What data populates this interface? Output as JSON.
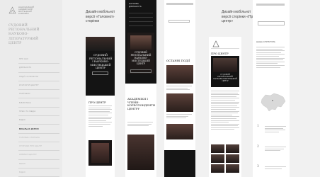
{
  "sidebar": {
    "logo_text": [
      "НАЦІОНАЛЬНИЙ",
      "АКАДЕМІЧНИЙ МИСТЕЦЬКИЙ",
      "КОМПЛЕКС"
    ],
    "title_lines": [
      "СУДОВИЙ РЕГІОНАЛЬНИЙ",
      "НАУКОВО-ЛІТЕРАТУРНИЙ",
      "ЦЕНТР"
    ],
    "nav": [
      {
        "label": "ПРО НАС",
        "state": "normal"
      },
      {
        "label": "ДІЯЛЬНІСТЬ",
        "state": "normal"
      },
      {
        "label": "ПОДІЇ ТА ПРОЄКТИ",
        "state": "normal"
      },
      {
        "label": "КОНТАКТИ ЦЕНТРУ",
        "state": "normal"
      },
      {
        "label": "ПАРТНЕРИ",
        "state": "normal"
      },
      {
        "label": "БІБЛІОТЕКА",
        "state": "normal"
      },
      {
        "label": "ПРЕСІ ТА МЕДІА",
        "state": "normal"
      },
      {
        "label": "ВІДЕО",
        "state": "normal"
      },
      {
        "label": "МОБІЛЬНА ВЕРСІЯ",
        "state": "active"
      },
      {
        "label": "ГОЛОВНА СТОРІНКА",
        "state": "sub"
      },
      {
        "label": "СТОРІНКА ПРО ЦЕНТР",
        "state": "sub"
      },
      {
        "label": "НОВИНИ ЦЕНТРУ",
        "state": "sub"
      },
      {
        "label": "МЕНЮ",
        "state": "sub"
      },
      {
        "label": "ВІДЕО",
        "state": "sub"
      }
    ]
  },
  "captions": {
    "main_page": [
      "Дизайн мобільної",
      "версії «Головної»",
      "сторінки"
    ],
    "about_page": [
      "Дизайн мобільної",
      "версії сторінки «Про",
      "центр»"
    ]
  },
  "phone1": {
    "hero_title": "СУДОВИЙ РЕГІОНАЛЬНИЙ І НАУКОВО-МИСТЕЦЬКИЙ ЦЕНТР",
    "section_title": "ПРО ЦЕНТР"
  },
  "phone2": {
    "menu_label": "НАУКОВА ДІЯЛЬНІСТЬ",
    "card_title": "СУДОВИЙ РЕГІОНАЛЬНИЙ НАУКОВО-МИСТЕЦЬКИЙ ЦЕНТР",
    "about_title": "АКАДЕМІКИ І ЧЛЕНИ-КОРЕСПОНДЕНТИ ЦЕНТРУ"
  },
  "phone3": {
    "section_title": "ОСТАННІ ПОДІЇ"
  },
  "phone4": {
    "title": "ПРО ЦЕНТР",
    "hero_title": "СУДОВИЙ РЕГІОНАЛЬНИЙ НАУКОВО-МИСТЕЦЬКИЙ ЦЕНТР"
  },
  "phone5": {
    "heading": "НАША СТРУКТУРА",
    "numbers": [
      "1",
      "2",
      "3"
    ]
  },
  "colors": {
    "background": "#f1f1f1",
    "dark": "#141414",
    "accent_brown": "#5c413a"
  }
}
